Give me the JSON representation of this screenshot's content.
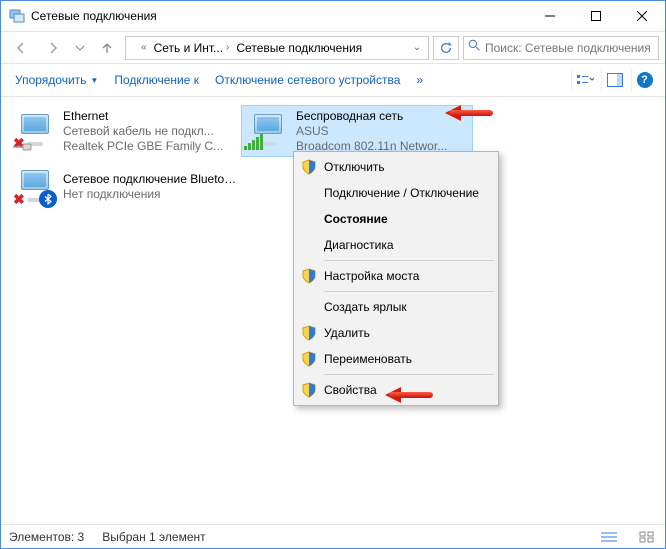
{
  "window": {
    "title": "Сетевые подключения"
  },
  "breadcrumb": {
    "part1": "Сеть и Инт...",
    "part2": "Сетевые подключения"
  },
  "search": {
    "placeholder": "Поиск: Сетевые подключения"
  },
  "commandbar": {
    "organize": "Упорядочить",
    "connect": "Подключение к",
    "disable": "Отключение сетевого устройства"
  },
  "connections": [
    {
      "name": "Ethernet",
      "status": "Сетевой кабель не подкл...",
      "device": "Realtek PCIe GBE Family C..."
    },
    {
      "name": "Беспроводная сеть",
      "status": "ASUS",
      "device": "Broadcom 802.11n Networ..."
    },
    {
      "name": "Сетевое подключение Bluetooth",
      "status": "Нет подключения",
      "device": ""
    }
  ],
  "context_menu": {
    "disable": "Отключить",
    "connect_disconnect": "Подключение / Отключение",
    "status": "Состояние",
    "diagnostics": "Диагностика",
    "bridge": "Настройка моста",
    "shortcut": "Создать ярлык",
    "delete": "Удалить",
    "rename": "Переименовать",
    "properties": "Свойства"
  },
  "statusbar": {
    "elements": "Элементов: 3",
    "selected": "Выбран 1 элемент"
  }
}
